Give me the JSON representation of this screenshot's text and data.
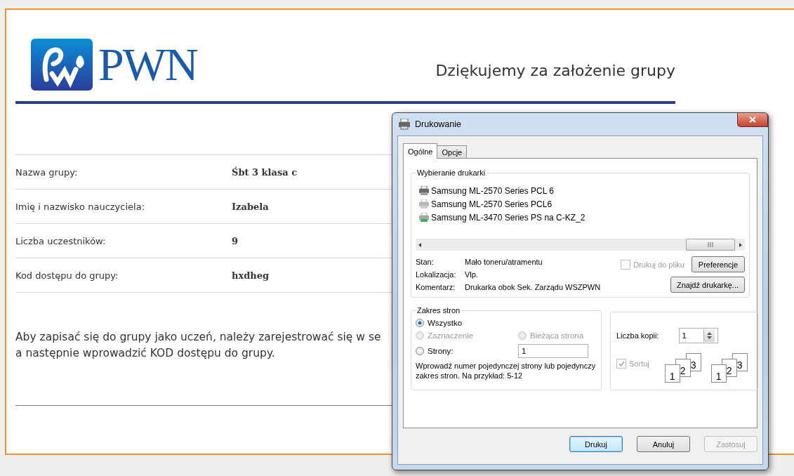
{
  "logo": {
    "text": "PWN"
  },
  "heading": "Dziękujemy za założenie grupy",
  "details": [
    {
      "label": "Nazwa grupy:",
      "value": "Śbt 3 klasa c"
    },
    {
      "label": "Imię i nazwisko nauczyciela:",
      "value": "Izabela"
    },
    {
      "label": "Liczba uczestników:",
      "value": "9"
    },
    {
      "label": "Kod dostępu do grupy:",
      "value": "hxdheg"
    }
  ],
  "instructions": [
    "Aby zapisać się do grupy jako uczeń, należy zarejestrować się w se",
    "a następnie wprowadzić KOD dostępu do grupy."
  ],
  "dialog": {
    "title": "Drukowanie",
    "tabs": [
      {
        "label": "Ogólne",
        "selected": true
      },
      {
        "label": "Opcje",
        "selected": false
      }
    ],
    "printer_group": {
      "title": "Wybieranie drukarki",
      "printers": [
        {
          "name": "Samsung ML-2570 Series PCL 6",
          "kind": "default"
        },
        {
          "name": "Samsung ML-2570 Series PCL6",
          "kind": "normal"
        },
        {
          "name": "Samsung ML-3470 Series PS na C-KZ_2",
          "kind": "network"
        }
      ],
      "info": [
        {
          "label": "Stan:",
          "value": "Mało toneru/atramentu"
        },
        {
          "label": "Lokalizacja:",
          "value": "Vlp."
        },
        {
          "label": "Komentarz:",
          "value": "Drukarka obok Sek. Zarządu WSZPWN"
        }
      ],
      "print_to_file": {
        "label": "Drukuj do pliku",
        "checked": false,
        "disabled": true
      },
      "preferences_button": "Preferencje",
      "find_button": "Znajdź drukarkę..."
    },
    "range_group": {
      "title": "Zakres stron",
      "options": [
        {
          "label": "Wszystko",
          "selected": true,
          "disabled": false
        },
        {
          "label": "Zaznaczenie",
          "selected": false,
          "disabled": true
        },
        {
          "label": "Bieżąca strona",
          "selected": false,
          "disabled": true
        },
        {
          "label": "Strony:",
          "selected": false,
          "disabled": false
        }
      ],
      "pages_value": "1",
      "hint": "Wprowadź numer pojedynczej strony lub pojedynczy zakres stron. Na przykład: 5-12"
    },
    "copies_group": {
      "label": "Liczba kopii:",
      "value": "1",
      "collate": {
        "label": "Sortuj",
        "checked": true,
        "disabled": true
      },
      "stacks": [
        [
          "1",
          "2",
          "3"
        ],
        [
          "1",
          "2",
          "3"
        ]
      ]
    },
    "buttons": [
      {
        "label": "Drukuj",
        "kind": "default",
        "disabled": false
      },
      {
        "label": "Anuluj",
        "kind": "normal",
        "disabled": false
      },
      {
        "label": "Zastosuj",
        "kind": "normal",
        "disabled": true
      }
    ]
  }
}
